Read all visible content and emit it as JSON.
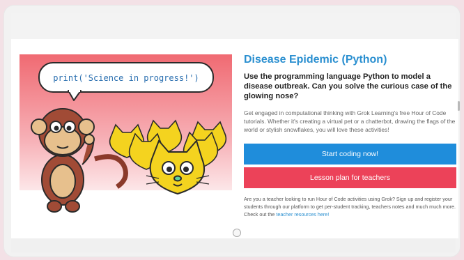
{
  "hero": {
    "code_snippet": "print('Science in progress!')",
    "alt": "Monkey and cats illustration"
  },
  "activity": {
    "title": "Disease Epidemic (Python)",
    "subtitle": "Use the programming language Python to model a disease outbreak. Can you solve the curious case of the glowing nose?",
    "description": "Get engaged in computational thinking with Grok Learning's free Hour of Code tutorials. Whether it's creating a virtual pet or a chatterbot, drawing the flags of the world or stylish snowflakes, you will love these activities!",
    "start_button": "Start coding now!",
    "lesson_button": "Lesson plan for teachers",
    "teacher_note": "Are you a teacher looking to run Hour of Code activities using Grok? Sign up and register your students through our platform to get per-student tracking, teachers notes and much much more. Check out the",
    "teacher_link": "teacher resources here!"
  },
  "colors": {
    "title_blue": "#2a8fd0",
    "button_blue": "#1f8ddb",
    "button_red": "#ec4259",
    "page_pink": "#f3e1e6"
  }
}
